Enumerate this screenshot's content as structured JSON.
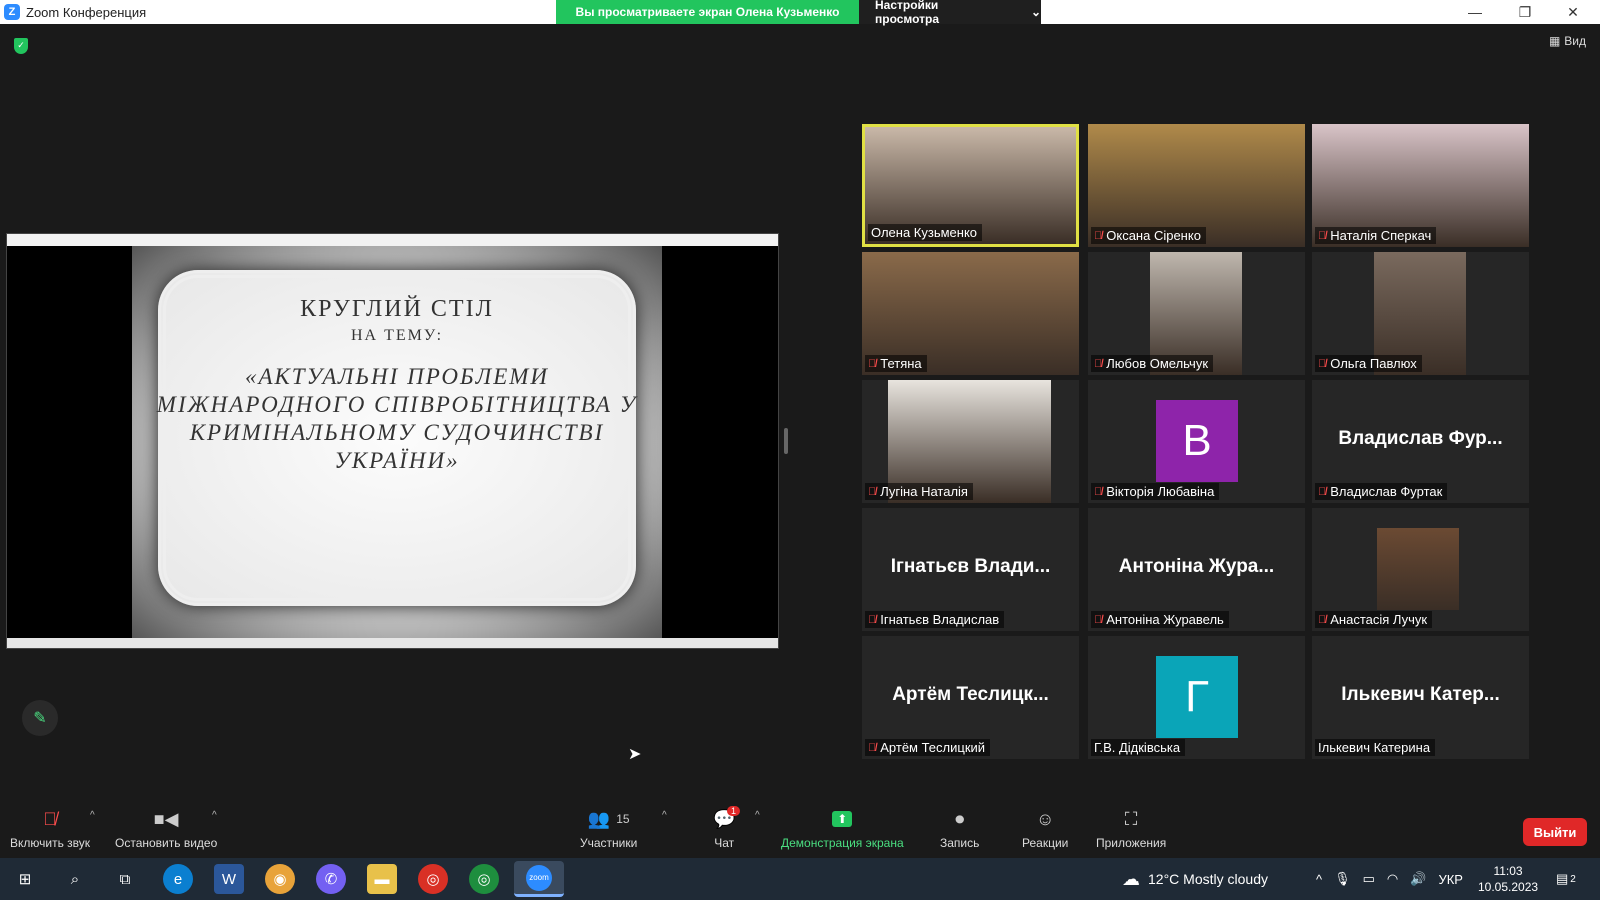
{
  "window": {
    "title": "Zoom Конференция",
    "share_banner": "Вы просматриваете экран Олена Кузьменко",
    "view_options": "Настройки просмотра",
    "view_button": "Вид"
  },
  "slide": {
    "line1": "КРУГЛИЙ СТІЛ",
    "line2": "НА ТЕМУ:",
    "quote": "«АКТУАЛЬНІ ПРОБЛЕМИ МІЖНАРОДНОГО СПІВРОБІТНИЦТВА У КРИМІНАЛЬНОМУ СУДОЧИНСТВІ УКРАЇНИ»"
  },
  "participants": [
    {
      "name": "Олена Кузьменко",
      "muted": false,
      "active": true,
      "type": "video",
      "color": "#c9b8a8"
    },
    {
      "name": "Оксана Сіренко",
      "muted": true,
      "type": "video",
      "color": "#b08a4a"
    },
    {
      "name": "Наталія Сперкач",
      "muted": true,
      "type": "video",
      "color": "#d9c4c8"
    },
    {
      "name": "Тетяна",
      "muted": true,
      "type": "video",
      "color": "#8a6a4a"
    },
    {
      "name": "Любов Омельчук",
      "muted": true,
      "type": "video",
      "color": "#bfb7ae"
    },
    {
      "name": "Ольга Павлюх",
      "muted": true,
      "type": "video",
      "color": "#7a6a5e"
    },
    {
      "name": "Лугіна Наталія",
      "muted": true,
      "type": "video",
      "color": "#e8e4de"
    },
    {
      "name": "Вікторія Любавіна",
      "muted": true,
      "type": "initial",
      "initial": "В",
      "color": "#8e24aa"
    },
    {
      "name": "Владислав Фуртак",
      "muted": true,
      "type": "name",
      "display": "Владислав Фур..."
    },
    {
      "name": "Ігнатьєв Владислав",
      "muted": true,
      "type": "name",
      "display": "Ігнатьєв Влади..."
    },
    {
      "name": "Антоніна Журавель",
      "muted": true,
      "type": "name",
      "display": "Антоніна Жура..."
    },
    {
      "name": "Анастасія Лучук",
      "muted": true,
      "type": "avatar",
      "color": "#6b4a33"
    },
    {
      "name": "Артём Теслицкий",
      "muted": true,
      "type": "name",
      "display": "Артём Теслицк..."
    },
    {
      "name": "Г.В. Дідківська",
      "muted": false,
      "type": "initial",
      "initial": "Г",
      "color": "#0aa5b8"
    },
    {
      "name": "Ількевич Катерина",
      "muted": false,
      "type": "name",
      "display": "Ількевич Катер..."
    }
  ],
  "toolbar": {
    "unmute": "Включить звук",
    "stop_video": "Остановить видео",
    "participants": "Участники",
    "participants_count": "15",
    "chat": "Чат",
    "chat_badge": "1",
    "share": "Демонстрация экрана",
    "record": "Запись",
    "reactions": "Реакции",
    "apps": "Приложения",
    "leave": "Выйти"
  },
  "taskbar": {
    "weather": "12°C  Mostly cloudy",
    "language": "УКР",
    "time": "11:03",
    "date": "10.05.2023",
    "notifications": "2"
  }
}
